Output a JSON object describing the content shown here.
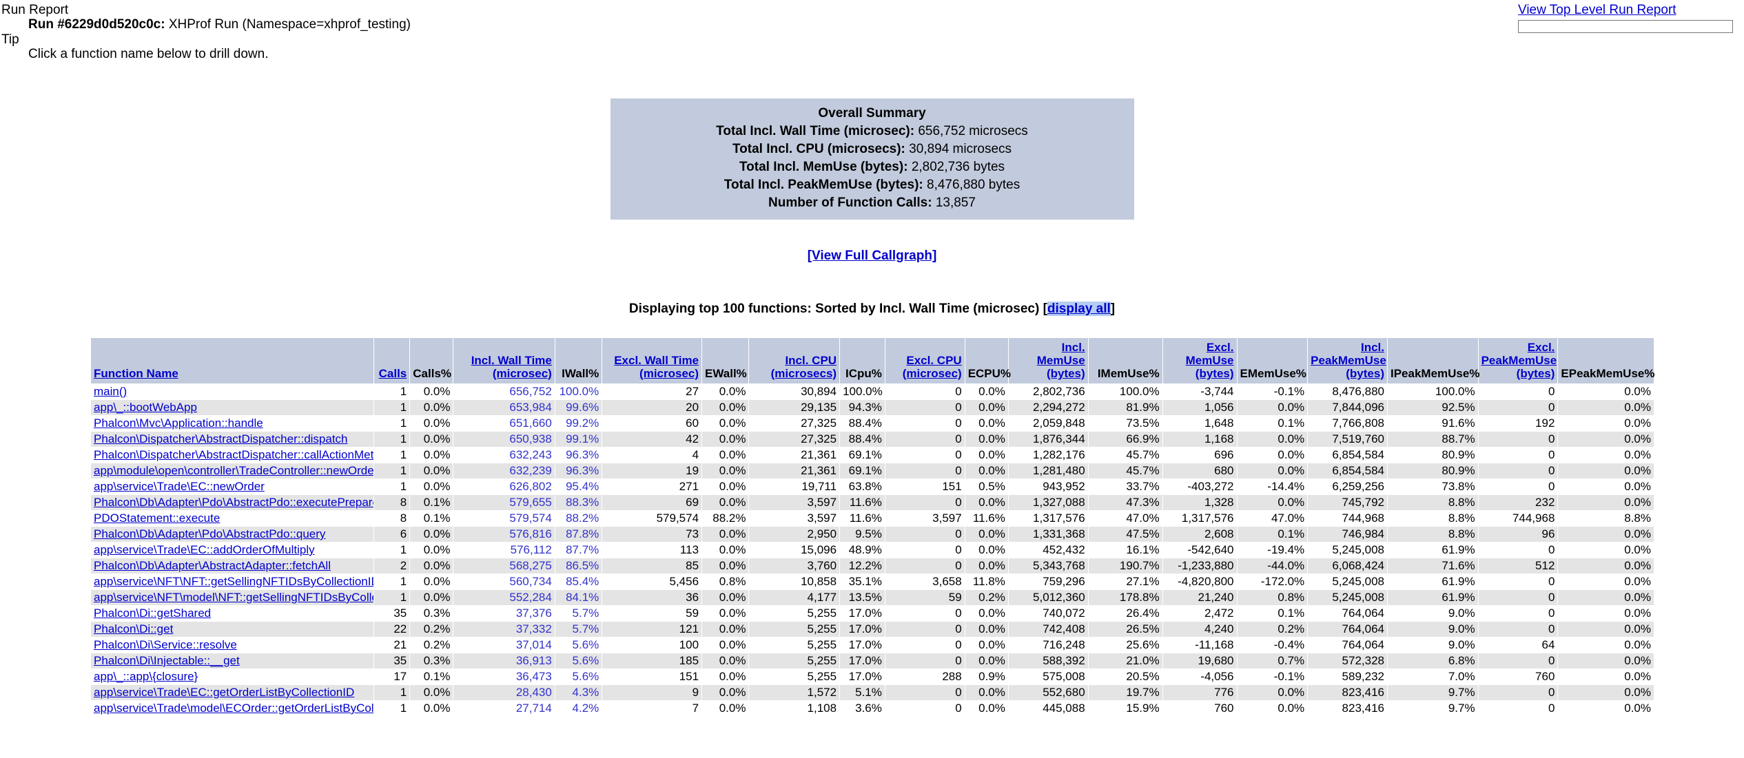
{
  "header": {
    "run_report_label": "Run Report",
    "run_id_label": "Run #6229d0d520c0c:",
    "run_description": "XHProf Run (Namespace=xhprof_testing)",
    "tip_label": "Tip",
    "tip_text": "Click a function name below to drill down.",
    "top_level_link": "View Top Level Run Report",
    "filter_value": "",
    "filter_placeholder": ""
  },
  "summary": {
    "title": "Overall Summary",
    "rows": [
      {
        "label": "Total Incl. Wall Time (microsec):",
        "value": "656,752 microsecs"
      },
      {
        "label": "Total Incl. CPU (microsecs):",
        "value": "30,894 microsecs"
      },
      {
        "label": "Total Incl. MemUse (bytes):",
        "value": "2,802,736 bytes"
      },
      {
        "label": "Total Incl. PeakMemUse (bytes):",
        "value": "8,476,880 bytes"
      },
      {
        "label": "Number of Function Calls:",
        "value": "13,857"
      }
    ]
  },
  "callgraph_link": "[View Full Callgraph]",
  "display_line": {
    "prefix": "Displaying top 100 functions: Sorted by Incl. Wall Time (microsec)",
    "bracket_open": "[",
    "link": "display all",
    "bracket_close": "]"
  },
  "table": {
    "headers": [
      {
        "label": "Function Name",
        "link": true,
        "align": "left"
      },
      {
        "label": "Calls",
        "link": true,
        "align": "right"
      },
      {
        "label": "Calls%",
        "link": false,
        "align": "right"
      },
      {
        "label": "Incl. Wall Time (microsec)",
        "link": true,
        "align": "right"
      },
      {
        "label": "IWall%",
        "link": false,
        "align": "right"
      },
      {
        "label": "Excl. Wall Time (microsec)",
        "link": true,
        "align": "right"
      },
      {
        "label": "EWall%",
        "link": false,
        "align": "right"
      },
      {
        "label": "Incl. CPU (microsecs)",
        "link": true,
        "align": "right"
      },
      {
        "label": "ICpu%",
        "link": false,
        "align": "right"
      },
      {
        "label": "Excl. CPU (microsec)",
        "link": true,
        "align": "right"
      },
      {
        "label": "ECPU%",
        "link": false,
        "align": "right"
      },
      {
        "label": "Incl. MemUse (bytes)",
        "link": true,
        "align": "right"
      },
      {
        "label": "IMemUse%",
        "link": false,
        "align": "right"
      },
      {
        "label": "Excl. MemUse (bytes)",
        "link": true,
        "align": "right"
      },
      {
        "label": "EMemUse%",
        "link": false,
        "align": "right"
      },
      {
        "label": "Incl. PeakMemUse (bytes)",
        "link": true,
        "align": "right"
      },
      {
        "label": "IPeakMemUse%",
        "link": false,
        "align": "right"
      },
      {
        "label": "Excl. PeakMemUse (bytes)",
        "link": true,
        "align": "right"
      },
      {
        "label": "EPeakMemUse%",
        "link": false,
        "align": "right"
      }
    ],
    "rows": [
      {
        "fn": "main()",
        "calls": "1",
        "calls_pct": "0.0%",
        "incl_wall": "656,752",
        "iwall_pct": "100.0%",
        "excl_wall": "27",
        "ewall_pct": "0.0%",
        "incl_cpu": "30,894",
        "icpu_pct": "100.0%",
        "excl_cpu": "0",
        "ecpu_pct": "0.0%",
        "incl_mem": "2,802,736",
        "imem_pct": "100.0%",
        "excl_mem": "-3,744",
        "emem_pct": "-0.1%",
        "incl_peak": "8,476,880",
        "ipeak_pct": "100.0%",
        "excl_peak": "0",
        "epeak_pct": "0.0%"
      },
      {
        "fn": "app\\_::bootWebApp",
        "calls": "1",
        "calls_pct": "0.0%",
        "incl_wall": "653,984",
        "iwall_pct": "99.6%",
        "excl_wall": "20",
        "ewall_pct": "0.0%",
        "incl_cpu": "29,135",
        "icpu_pct": "94.3%",
        "excl_cpu": "0",
        "ecpu_pct": "0.0%",
        "incl_mem": "2,294,272",
        "imem_pct": "81.9%",
        "excl_mem": "1,056",
        "emem_pct": "0.0%",
        "incl_peak": "7,844,096",
        "ipeak_pct": "92.5%",
        "excl_peak": "0",
        "epeak_pct": "0.0%"
      },
      {
        "fn": "Phalcon\\Mvc\\Application::handle",
        "calls": "1",
        "calls_pct": "0.0%",
        "incl_wall": "651,660",
        "iwall_pct": "99.2%",
        "excl_wall": "60",
        "ewall_pct": "0.0%",
        "incl_cpu": "27,325",
        "icpu_pct": "88.4%",
        "excl_cpu": "0",
        "ecpu_pct": "0.0%",
        "incl_mem": "2,059,848",
        "imem_pct": "73.5%",
        "excl_mem": "1,648",
        "emem_pct": "0.1%",
        "incl_peak": "7,766,808",
        "ipeak_pct": "91.6%",
        "excl_peak": "192",
        "epeak_pct": "0.0%"
      },
      {
        "fn": "Phalcon\\Dispatcher\\AbstractDispatcher::dispatch",
        "calls": "1",
        "calls_pct": "0.0%",
        "incl_wall": "650,938",
        "iwall_pct": "99.1%",
        "excl_wall": "42",
        "ewall_pct": "0.0%",
        "incl_cpu": "27,325",
        "icpu_pct": "88.4%",
        "excl_cpu": "0",
        "ecpu_pct": "0.0%",
        "incl_mem": "1,876,344",
        "imem_pct": "66.9%",
        "excl_mem": "1,168",
        "emem_pct": "0.0%",
        "incl_peak": "7,519,760",
        "ipeak_pct": "88.7%",
        "excl_peak": "0",
        "epeak_pct": "0.0%"
      },
      {
        "fn": "Phalcon\\Dispatcher\\AbstractDispatcher::callActionMethod",
        "calls": "1",
        "calls_pct": "0.0%",
        "incl_wall": "632,243",
        "iwall_pct": "96.3%",
        "excl_wall": "4",
        "ewall_pct": "0.0%",
        "incl_cpu": "21,361",
        "icpu_pct": "69.1%",
        "excl_cpu": "0",
        "ecpu_pct": "0.0%",
        "incl_mem": "1,282,176",
        "imem_pct": "45.7%",
        "excl_mem": "696",
        "emem_pct": "0.0%",
        "incl_peak": "6,854,584",
        "ipeak_pct": "80.9%",
        "excl_peak": "0",
        "epeak_pct": "0.0%"
      },
      {
        "fn": "app\\module\\open\\controller\\TradeController::newOrderAction",
        "calls": "1",
        "calls_pct": "0.0%",
        "incl_wall": "632,239",
        "iwall_pct": "96.3%",
        "excl_wall": "19",
        "ewall_pct": "0.0%",
        "incl_cpu": "21,361",
        "icpu_pct": "69.1%",
        "excl_cpu": "0",
        "ecpu_pct": "0.0%",
        "incl_mem": "1,281,480",
        "imem_pct": "45.7%",
        "excl_mem": "680",
        "emem_pct": "0.0%",
        "incl_peak": "6,854,584",
        "ipeak_pct": "80.9%",
        "excl_peak": "0",
        "epeak_pct": "0.0%"
      },
      {
        "fn": "app\\service\\Trade\\EC::newOrder",
        "calls": "1",
        "calls_pct": "0.0%",
        "incl_wall": "626,802",
        "iwall_pct": "95.4%",
        "excl_wall": "271",
        "ewall_pct": "0.0%",
        "incl_cpu": "19,711",
        "icpu_pct": "63.8%",
        "excl_cpu": "151",
        "ecpu_pct": "0.5%",
        "incl_mem": "943,952",
        "imem_pct": "33.7%",
        "excl_mem": "-403,272",
        "emem_pct": "-14.4%",
        "incl_peak": "6,259,256",
        "ipeak_pct": "73.8%",
        "excl_peak": "0",
        "epeak_pct": "0.0%"
      },
      {
        "fn": "Phalcon\\Db\\Adapter\\Pdo\\AbstractPdo::executePrepared",
        "calls": "8",
        "calls_pct": "0.1%",
        "incl_wall": "579,655",
        "iwall_pct": "88.3%",
        "excl_wall": "69",
        "ewall_pct": "0.0%",
        "incl_cpu": "3,597",
        "icpu_pct": "11.6%",
        "excl_cpu": "0",
        "ecpu_pct": "0.0%",
        "incl_mem": "1,327,088",
        "imem_pct": "47.3%",
        "excl_mem": "1,328",
        "emem_pct": "0.0%",
        "incl_peak": "745,792",
        "ipeak_pct": "8.8%",
        "excl_peak": "232",
        "epeak_pct": "0.0%"
      },
      {
        "fn": "PDOStatement::execute",
        "calls": "8",
        "calls_pct": "0.1%",
        "incl_wall": "579,574",
        "iwall_pct": "88.2%",
        "excl_wall": "579,574",
        "ewall_pct": "88.2%",
        "incl_cpu": "3,597",
        "icpu_pct": "11.6%",
        "excl_cpu": "3,597",
        "ecpu_pct": "11.6%",
        "incl_mem": "1,317,576",
        "imem_pct": "47.0%",
        "excl_mem": "1,317,576",
        "emem_pct": "47.0%",
        "incl_peak": "744,968",
        "ipeak_pct": "8.8%",
        "excl_peak": "744,968",
        "epeak_pct": "8.8%"
      },
      {
        "fn": "Phalcon\\Db\\Adapter\\Pdo\\AbstractPdo::query",
        "calls": "6",
        "calls_pct": "0.0%",
        "incl_wall": "576,816",
        "iwall_pct": "87.8%",
        "excl_wall": "73",
        "ewall_pct": "0.0%",
        "incl_cpu": "2,950",
        "icpu_pct": "9.5%",
        "excl_cpu": "0",
        "ecpu_pct": "0.0%",
        "incl_mem": "1,331,368",
        "imem_pct": "47.5%",
        "excl_mem": "2,608",
        "emem_pct": "0.1%",
        "incl_peak": "746,984",
        "ipeak_pct": "8.8%",
        "excl_peak": "96",
        "epeak_pct": "0.0%"
      },
      {
        "fn": "app\\service\\Trade\\EC::addOrderOfMultiply",
        "calls": "1",
        "calls_pct": "0.0%",
        "incl_wall": "576,112",
        "iwall_pct": "87.7%",
        "excl_wall": "113",
        "ewall_pct": "0.0%",
        "incl_cpu": "15,096",
        "icpu_pct": "48.9%",
        "excl_cpu": "0",
        "ecpu_pct": "0.0%",
        "incl_mem": "452,432",
        "imem_pct": "16.1%",
        "excl_mem": "-542,640",
        "emem_pct": "-19.4%",
        "incl_peak": "5,245,008",
        "ipeak_pct": "61.9%",
        "excl_peak": "0",
        "epeak_pct": "0.0%"
      },
      {
        "fn": "Phalcon\\Db\\Adapter\\AbstractAdapter::fetchAll",
        "calls": "2",
        "calls_pct": "0.0%",
        "incl_wall": "568,275",
        "iwall_pct": "86.5%",
        "excl_wall": "85",
        "ewall_pct": "0.0%",
        "incl_cpu": "3,760",
        "icpu_pct": "12.2%",
        "excl_cpu": "0",
        "ecpu_pct": "0.0%",
        "incl_mem": "5,343,768",
        "imem_pct": "190.7%",
        "excl_mem": "-1,233,880",
        "emem_pct": "-44.0%",
        "incl_peak": "6,068,424",
        "ipeak_pct": "71.6%",
        "excl_peak": "512",
        "epeak_pct": "0.0%"
      },
      {
        "fn": "app\\service\\NFT\\NFT::getSellingNFTIDsByCollectionID",
        "calls": "1",
        "calls_pct": "0.0%",
        "incl_wall": "560,734",
        "iwall_pct": "85.4%",
        "excl_wall": "5,456",
        "ewall_pct": "0.8%",
        "incl_cpu": "10,858",
        "icpu_pct": "35.1%",
        "excl_cpu": "3,658",
        "ecpu_pct": "11.8%",
        "incl_mem": "759,296",
        "imem_pct": "27.1%",
        "excl_mem": "-4,820,800",
        "emem_pct": "-172.0%",
        "incl_peak": "5,245,008",
        "ipeak_pct": "61.9%",
        "excl_peak": "0",
        "epeak_pct": "0.0%"
      },
      {
        "fn": "app\\service\\NFT\\model\\NFT::getSellingNFTIDsByCollectionID",
        "calls": "1",
        "calls_pct": "0.0%",
        "incl_wall": "552,284",
        "iwall_pct": "84.1%",
        "excl_wall": "36",
        "ewall_pct": "0.0%",
        "incl_cpu": "4,177",
        "icpu_pct": "13.5%",
        "excl_cpu": "59",
        "ecpu_pct": "0.2%",
        "incl_mem": "5,012,360",
        "imem_pct": "178.8%",
        "excl_mem": "21,240",
        "emem_pct": "0.8%",
        "incl_peak": "5,245,008",
        "ipeak_pct": "61.9%",
        "excl_peak": "0",
        "epeak_pct": "0.0%"
      },
      {
        "fn": "Phalcon\\Di::getShared",
        "calls": "35",
        "calls_pct": "0.3%",
        "incl_wall": "37,376",
        "iwall_pct": "5.7%",
        "excl_wall": "59",
        "ewall_pct": "0.0%",
        "incl_cpu": "5,255",
        "icpu_pct": "17.0%",
        "excl_cpu": "0",
        "ecpu_pct": "0.0%",
        "incl_mem": "740,072",
        "imem_pct": "26.4%",
        "excl_mem": "2,472",
        "emem_pct": "0.1%",
        "incl_peak": "764,064",
        "ipeak_pct": "9.0%",
        "excl_peak": "0",
        "epeak_pct": "0.0%"
      },
      {
        "fn": "Phalcon\\Di::get",
        "calls": "22",
        "calls_pct": "0.2%",
        "incl_wall": "37,332",
        "iwall_pct": "5.7%",
        "excl_wall": "121",
        "ewall_pct": "0.0%",
        "incl_cpu": "5,255",
        "icpu_pct": "17.0%",
        "excl_cpu": "0",
        "ecpu_pct": "0.0%",
        "incl_mem": "742,408",
        "imem_pct": "26.5%",
        "excl_mem": "4,240",
        "emem_pct": "0.2%",
        "incl_peak": "764,064",
        "ipeak_pct": "9.0%",
        "excl_peak": "0",
        "epeak_pct": "0.0%"
      },
      {
        "fn": "Phalcon\\Di\\Service::resolve",
        "calls": "21",
        "calls_pct": "0.2%",
        "incl_wall": "37,014",
        "iwall_pct": "5.6%",
        "excl_wall": "100",
        "ewall_pct": "0.0%",
        "incl_cpu": "5,255",
        "icpu_pct": "17.0%",
        "excl_cpu": "0",
        "ecpu_pct": "0.0%",
        "incl_mem": "716,248",
        "imem_pct": "25.6%",
        "excl_mem": "-11,168",
        "emem_pct": "-0.4%",
        "incl_peak": "764,064",
        "ipeak_pct": "9.0%",
        "excl_peak": "64",
        "epeak_pct": "0.0%"
      },
      {
        "fn": "Phalcon\\Di\\Injectable::__get",
        "calls": "35",
        "calls_pct": "0.3%",
        "incl_wall": "36,913",
        "iwall_pct": "5.6%",
        "excl_wall": "185",
        "ewall_pct": "0.0%",
        "incl_cpu": "5,255",
        "icpu_pct": "17.0%",
        "excl_cpu": "0",
        "ecpu_pct": "0.0%",
        "incl_mem": "588,392",
        "imem_pct": "21.0%",
        "excl_mem": "19,680",
        "emem_pct": "0.7%",
        "incl_peak": "572,328",
        "ipeak_pct": "6.8%",
        "excl_peak": "0",
        "epeak_pct": "0.0%"
      },
      {
        "fn": "app\\_::app\\{closure}",
        "calls": "17",
        "calls_pct": "0.1%",
        "incl_wall": "36,473",
        "iwall_pct": "5.6%",
        "excl_wall": "151",
        "ewall_pct": "0.0%",
        "incl_cpu": "5,255",
        "icpu_pct": "17.0%",
        "excl_cpu": "288",
        "ecpu_pct": "0.9%",
        "incl_mem": "575,008",
        "imem_pct": "20.5%",
        "excl_mem": "-4,056",
        "emem_pct": "-0.1%",
        "incl_peak": "589,232",
        "ipeak_pct": "7.0%",
        "excl_peak": "760",
        "epeak_pct": "0.0%"
      },
      {
        "fn": "app\\service\\Trade\\EC::getOrderListByCollectionID",
        "calls": "1",
        "calls_pct": "0.0%",
        "incl_wall": "28,430",
        "iwall_pct": "4.3%",
        "excl_wall": "9",
        "ewall_pct": "0.0%",
        "incl_cpu": "1,572",
        "icpu_pct": "5.1%",
        "excl_cpu": "0",
        "ecpu_pct": "0.0%",
        "incl_mem": "552,680",
        "imem_pct": "19.7%",
        "excl_mem": "776",
        "emem_pct": "0.0%",
        "incl_peak": "823,416",
        "ipeak_pct": "9.7%",
        "excl_peak": "0",
        "epeak_pct": "0.0%"
      },
      {
        "fn": "app\\service\\Trade\\model\\ECOrder::getOrderListByCollectionID",
        "calls": "1",
        "calls_pct": "0.0%",
        "incl_wall": "27,714",
        "iwall_pct": "4.2%",
        "excl_wall": "7",
        "ewall_pct": "0.0%",
        "incl_cpu": "1,108",
        "icpu_pct": "3.6%",
        "excl_cpu": "0",
        "ecpu_pct": "0.0%",
        "incl_mem": "445,088",
        "imem_pct": "15.9%",
        "excl_mem": "760",
        "emem_pct": "0.0%",
        "incl_peak": "823,416",
        "ipeak_pct": "9.7%",
        "excl_peak": "0",
        "epeak_pct": "0.0%"
      }
    ]
  }
}
